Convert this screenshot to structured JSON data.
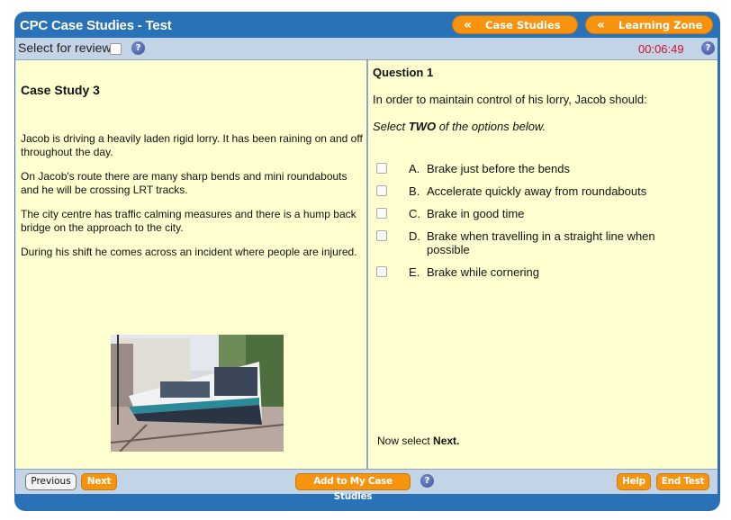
{
  "app": {
    "title": "CPC Case Studies - Test"
  },
  "nav": {
    "case_studies": "Case Studies",
    "learning_zone": "Learning Zone",
    "chevron": "«"
  },
  "subbar": {
    "review_label": "Select for review",
    "review_checked": false,
    "timer": "00:06:49",
    "help_glyph": "?"
  },
  "case_study": {
    "title": "Case Study 3",
    "paragraphs": [
      "Jacob is driving a heavily laden rigid lorry. It has been raining on and off throughout the day.",
      "On Jacob's route there are many sharp bends and mini roundabouts and he will be crossing LRT tracks.",
      "The city centre has traffic calming measures and there is a hump back bridge on the approach to the city.",
      "During his shift he comes across an incident where people are injured."
    ],
    "image_alt": "tram-photo"
  },
  "question": {
    "title": "Question 1",
    "text": "In order to maintain control of his lorry, Jacob should:",
    "instruction_pre": "Select ",
    "instruction_bold": "TWO",
    "instruction_post": " of the options below.",
    "options": [
      {
        "letter": "A.",
        "text": "Brake just before the bends",
        "checked": false
      },
      {
        "letter": "B.",
        "text": "Accelerate quickly away from roundabouts",
        "checked": false
      },
      {
        "letter": "C.",
        "text": "Brake in good time",
        "checked": false
      },
      {
        "letter": "D.",
        "text": "Brake when travelling in a straight line when possible",
        "checked": false
      },
      {
        "letter": "E.",
        "text": "Brake while cornering",
        "checked": false
      }
    ],
    "now_select_pre": "Now select ",
    "now_select_bold": "Next."
  },
  "footer": {
    "previous": "Previous",
    "next": "Next",
    "add_to_my": "Add to My Case Studies",
    "help": "Help",
    "end_test": "End Test"
  },
  "colors": {
    "frame_blue": "#2a72b8",
    "bar_grey_blue": "#c3d4e6",
    "content_yellow": "#ffffd0",
    "accent_orange": "#f7930f",
    "timer_red": "#d0102a"
  }
}
